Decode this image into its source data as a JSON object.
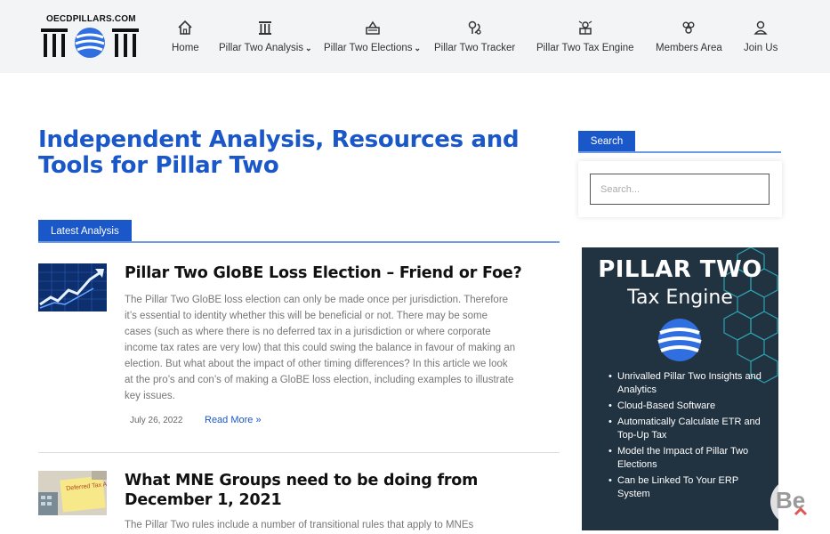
{
  "header": {
    "logo_text": "OECDPILLARS.COM",
    "nav": [
      {
        "label": "Home",
        "icon": "home-icon"
      },
      {
        "label": "Pillar Two Analysis",
        "icon": "pillar-icon",
        "has_dropdown": true
      },
      {
        "label": "Pillar Two Elections",
        "icon": "ballot-icon",
        "has_dropdown": true
      },
      {
        "label": "Pillar Two Tracker",
        "icon": "tracker-icon"
      },
      {
        "label": "Pillar Two Tax Engine",
        "icon": "engine-icon"
      },
      {
        "label": "Members Area",
        "icon": "members-icon"
      },
      {
        "label": "Join Us",
        "icon": "user-icon"
      }
    ]
  },
  "main": {
    "title": "Independent Analysis, Resources and Tools for Pillar Two",
    "section_label": "Latest Analysis",
    "posts": [
      {
        "title": "Pillar Two GloBE Loss Election – Friend or Foe?",
        "excerpt": "The Pillar Two GloBE loss election can only be made once per jurisdiction. Therefore it’s essential to identity whether this will be beneficial or not. There may be some cases (such as where there is no deferred tax in a jurisdiction or where corporate income tax rates are very low) that this could swing the balance in favour of making an election. But what about the impact of other timing differences? In this article we look at the pro’s and con’s of making a GloBE loss election, including examples to illustrate key issues.",
        "date": "July 26, 2022",
        "read_more": "Read More »",
        "thumb": "growth-chart-thumbnail"
      },
      {
        "title": "What MNE Groups need to be doing from December 1, 2021",
        "excerpt": "The Pillar Two rules include a number of transitional rules that apply to MNEs",
        "thumb": "deferred-tax-asset-thumbnail",
        "thumb_text": "Deferred Tax Asset"
      }
    ]
  },
  "sidebar": {
    "search_label": "Search",
    "search_placeholder": "Search...",
    "ad": {
      "title": "PILLAR TWO",
      "subtitle": "Tax Engine",
      "bullets": [
        "Unrivalled  Pillar Two Insights and Analytics",
        "Cloud-Based Software",
        "Automatically Calculate ETR and Top-Up Tax",
        "Model the Impact of Pillar Two Elections",
        "Can be Linked To Your ERP System"
      ]
    }
  },
  "watermark": "Be",
  "colors": {
    "accent": "#1a57c8",
    "ad_bg": "#213240",
    "topbar": "#f3f4f6"
  }
}
